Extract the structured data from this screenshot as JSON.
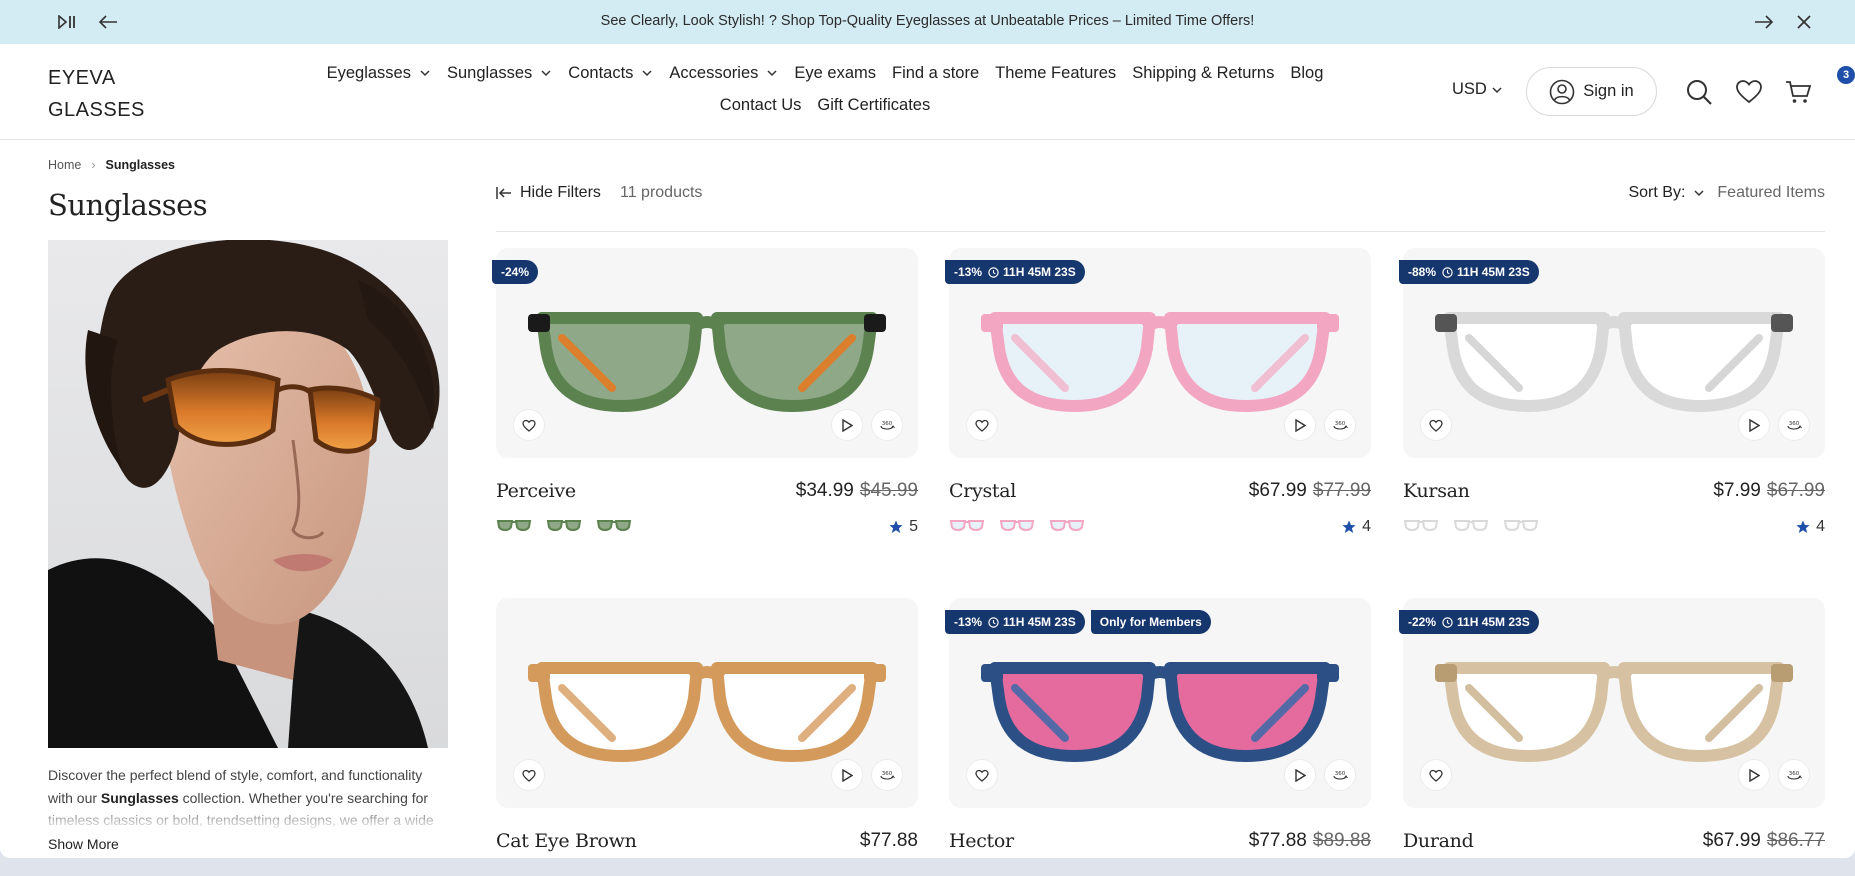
{
  "announcement": {
    "message": "See Clearly, Look Stylish! ? Shop Top-Quality Eyeglasses at Unbeatable Prices – Limited Time Offers!"
  },
  "header": {
    "logo_line1": "EYEVA",
    "logo_line2": "GLASSES",
    "nav": [
      {
        "label": "Eyeglasses"
      },
      {
        "label": "Sunglasses"
      },
      {
        "label": "Contacts"
      },
      {
        "label": "Accessories"
      },
      {
        "label": "Eye exams"
      },
      {
        "label": "Find a store"
      },
      {
        "label": "Theme Features"
      },
      {
        "label": "Shipping & Returns"
      },
      {
        "label": "Blog"
      },
      {
        "label": "Contact Us"
      },
      {
        "label": "Gift Certificates"
      }
    ],
    "currency": "USD",
    "signin_label": "Sign in",
    "cart_count": "3"
  },
  "breadcrumb": {
    "home": "Home",
    "current": "Sunglasses"
  },
  "page": {
    "title": "Sunglasses",
    "desc_part1": "Discover the perfect blend of style, comfort, and functionality with our ",
    "desc_bold": "Sunglasses",
    "desc_part2": " collection. Whether you're searching for timeless classics or bold, trendsetting designs, we offer a wide",
    "show_more": "Show More"
  },
  "toolbar": {
    "hide_filters": "Hide Filters",
    "product_count": "11 products",
    "sort_label": "Sort By:",
    "sort_value": "Featured Items"
  },
  "products": [
    {
      "name": "Perceive",
      "price": "$34.99",
      "old_price": "$45.99",
      "discount": "-24%",
      "timer": "",
      "member": "",
      "rating": "5",
      "frame_color": "#5c8250",
      "lens_color": "#8fa887",
      "temple_color": "#e9781e",
      "accent": "#1a1a1a"
    },
    {
      "name": "Crystal",
      "price": "$67.99",
      "old_price": "$77.99",
      "discount": "-13%",
      "timer": "11H 45M 23S",
      "member": "",
      "rating": "4",
      "frame_color": "#f2a6c2",
      "lens_color": "#e7f1f8",
      "temple_color": "#f2b7cc",
      "accent": "#f2a6c2"
    },
    {
      "name": "Kursan",
      "price": "$7.99",
      "old_price": "$67.99",
      "discount": "-88%",
      "timer": "11H 45M 23S",
      "member": "",
      "rating": "4",
      "frame_color": "#d9d9d9",
      "lens_color": "#ffffff",
      "temple_color": "#cfcfcf",
      "accent": "#555555"
    },
    {
      "name": "Cat Eye Brown",
      "price": "$77.88",
      "old_price": "",
      "discount": "",
      "timer": "",
      "member": "",
      "rating": "",
      "frame_color": "#d39a5c",
      "lens_color": "#ffffff",
      "temple_color": "#d9a36a",
      "accent": "#d39a5c"
    },
    {
      "name": "Hector",
      "price": "$77.88",
      "old_price": "$89.88",
      "discount": "-13%",
      "timer": "11H 45M 23S",
      "member": "Only for Members",
      "rating": "",
      "frame_color": "#2c4f86",
      "lens_color": "#e56a9e",
      "temple_color": "#3a6aa8",
      "accent": "#2c4f86"
    },
    {
      "name": "Durand",
      "price": "$67.99",
      "old_price": "$86.77",
      "discount": "-22%",
      "timer": "11H 45M 23S",
      "member": "",
      "rating": "",
      "frame_color": "#d6c2a2",
      "lens_color": "#ffffff",
      "temple_color": "#cbb48f",
      "accent": "#b89c72"
    }
  ]
}
